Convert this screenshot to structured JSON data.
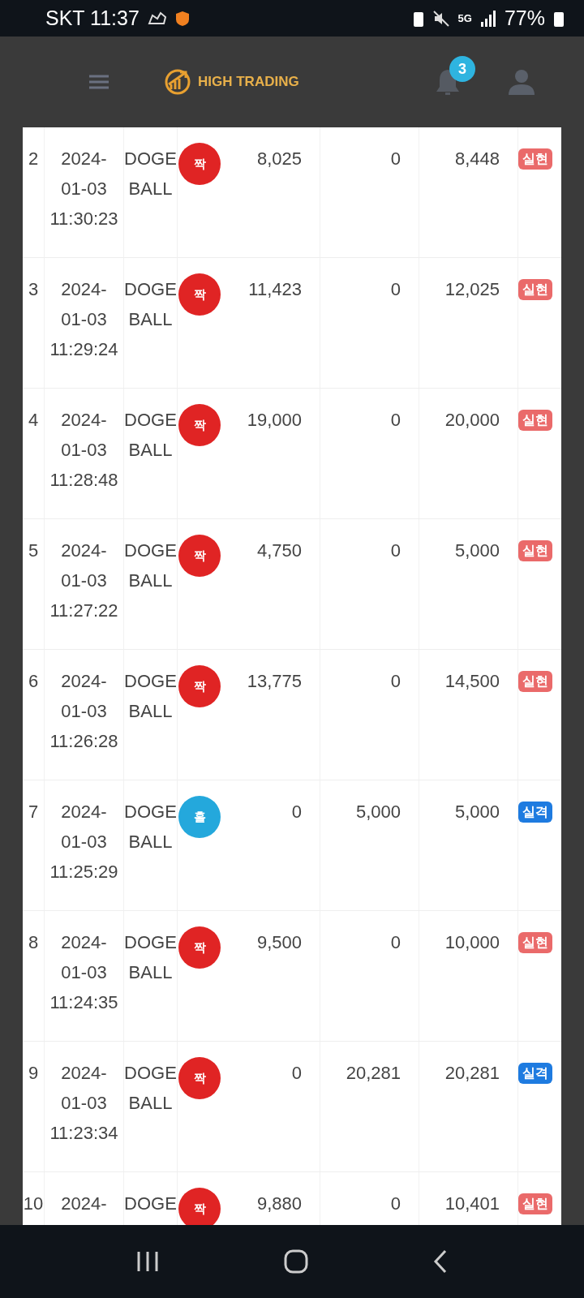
{
  "status_bar": {
    "carrier_time": "SKT 11:37",
    "network": "5G",
    "battery": "77%"
  },
  "header": {
    "logo": "HIGH TRADING",
    "notifications": "3"
  },
  "rows": [
    {
      "no": "2",
      "date": [
        "2024-",
        "01-03",
        "11:30:23"
      ],
      "name": [
        "DOGE",
        "BALL"
      ],
      "ball": {
        "label": "짝",
        "color": "#e02424"
      },
      "col5": "8,025",
      "col6": "0",
      "col7": "8,448",
      "result": {
        "label": "실현",
        "color": "#ea6a6a"
      }
    },
    {
      "no": "3",
      "date": [
        "2024-",
        "01-03",
        "11:29:24"
      ],
      "name": [
        "DOGE",
        "BALL"
      ],
      "ball": {
        "label": "짝",
        "color": "#e02424"
      },
      "col5": "11,423",
      "col6": "0",
      "col7": "12,025",
      "result": {
        "label": "실현",
        "color": "#ea6a6a"
      }
    },
    {
      "no": "4",
      "date": [
        "2024-",
        "01-03",
        "11:28:48"
      ],
      "name": [
        "DOGE",
        "BALL"
      ],
      "ball": {
        "label": "짝",
        "color": "#e02424"
      },
      "col5": "19,000",
      "col6": "0",
      "col7": "20,000",
      "result": {
        "label": "실현",
        "color": "#ea6a6a"
      }
    },
    {
      "no": "5",
      "date": [
        "2024-",
        "01-03",
        "11:27:22"
      ],
      "name": [
        "DOGE",
        "BALL"
      ],
      "ball": {
        "label": "짝",
        "color": "#e02424"
      },
      "col5": "4,750",
      "col6": "0",
      "col7": "5,000",
      "result": {
        "label": "실현",
        "color": "#ea6a6a"
      }
    },
    {
      "no": "6",
      "date": [
        "2024-",
        "01-03",
        "11:26:28"
      ],
      "name": [
        "DOGE",
        "BALL"
      ],
      "ball": {
        "label": "짝",
        "color": "#e02424"
      },
      "col5": "13,775",
      "col6": "0",
      "col7": "14,500",
      "result": {
        "label": "실현",
        "color": "#ea6a6a"
      }
    },
    {
      "no": "7",
      "date": [
        "2024-",
        "01-03",
        "11:25:29"
      ],
      "name": [
        "DOGE",
        "BALL"
      ],
      "ball": {
        "label": "홀",
        "color": "#24a8dc"
      },
      "col5": "0",
      "col6": "5,000",
      "col7": "5,000",
      "result": {
        "label": "실격",
        "color": "#1e7be0"
      }
    },
    {
      "no": "8",
      "date": [
        "2024-",
        "01-03",
        "11:24:35"
      ],
      "name": [
        "DOGE",
        "BALL"
      ],
      "ball": {
        "label": "짝",
        "color": "#e02424"
      },
      "col5": "9,500",
      "col6": "0",
      "col7": "10,000",
      "result": {
        "label": "실현",
        "color": "#ea6a6a"
      }
    },
    {
      "no": "9",
      "date": [
        "2024-",
        "01-03",
        "11:23:34"
      ],
      "name": [
        "DOGE",
        "BALL"
      ],
      "ball": {
        "label": "짝",
        "color": "#e02424"
      },
      "col5": "0",
      "col6": "20,281",
      "col7": "20,281",
      "result": {
        "label": "실격",
        "color": "#1e7be0"
      }
    },
    {
      "no": "10",
      "date": [
        "2024-"
      ],
      "name": [
        "DOGE"
      ],
      "ball": {
        "label": "짝",
        "color": "#e02424"
      },
      "col5": "9,880",
      "col6": "0",
      "col7": "10,401",
      "result": {
        "label": "실현",
        "color": "#ea6a6a"
      }
    }
  ]
}
